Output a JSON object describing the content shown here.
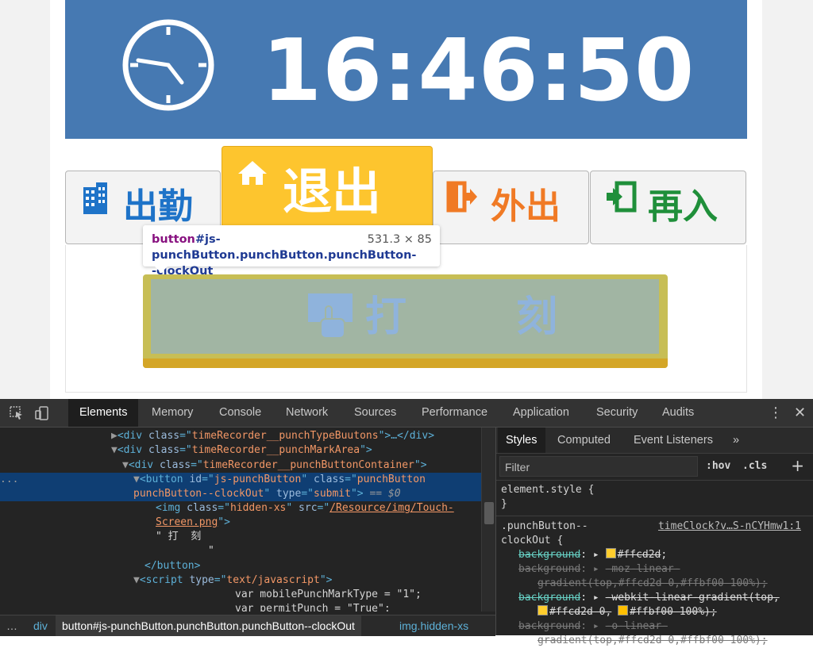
{
  "clock": {
    "time": "16:46:50"
  },
  "punch_types": {
    "clock_in": "出勤",
    "clock_out": "退出",
    "go_out": "外出",
    "return": "再入"
  },
  "punch_button": {
    "label": "打 刻"
  },
  "tooltip": {
    "tag": "button",
    "selector": "#js-punchButton.punchButton.punchButton--clockOut",
    "dimensions": "531.3 × 85"
  },
  "devtools": {
    "tabs": [
      "Elements",
      "Memory",
      "Console",
      "Network",
      "Sources",
      "Performance",
      "Application",
      "Security",
      "Audits"
    ],
    "active_tab": "Elements",
    "dom_lines": [
      {
        "tag": "div",
        "attr": "class",
        "value": "timeRecorder__punchTypeBuutons",
        "tail": ">…</div>"
      },
      {
        "tag": "div",
        "attr": "class",
        "value": "timeRecorder__punchMarkArea",
        "tail": ">"
      },
      {
        "tag": "div",
        "attr": "class",
        "value": "timeRecorder__punchButtonContainer",
        "tail": ">"
      },
      {
        "tag": "button",
        "attr1": "id",
        "value1": "js-punchButton",
        "attr2": "class",
        "value2a": "punchButton",
        "value2b": "punchButton--clockOut",
        "attr3": "type",
        "value3": "submit",
        "marker": "== $0"
      },
      {
        "tag": "img",
        "attr": "class",
        "value": "hidden-xs",
        "attr_src": "src",
        "src_a": "/Resource/img/Touch-",
        "src_b": "Screen.png"
      },
      {
        "text_a": "\" 打  刻",
        "text_b": "\""
      },
      {
        "close": "</button>"
      },
      {
        "tag": "script",
        "attr": "type",
        "value": "text/javascript"
      },
      {
        "js_a": "var mobilePunchMarkType = \"1\";",
        "js_b": "var permitPunch = \"True\";"
      }
    ],
    "breadcrumbs": [
      "…",
      "div",
      "button#js-punchButton.punchButton.punchButton--clockOut",
      "img.hidden-xs"
    ],
    "styles_tabs": [
      "Styles",
      "Computed",
      "Event Listeners",
      "»"
    ],
    "filter_placeholder": "Filter",
    "hov": ":hov",
    "cls": ".cls",
    "plus": "+",
    "element_style": "element.style {",
    "element_style_close": "}",
    "rule_selector_a": ".punchButton--",
    "rule_selector_b": "clockOut {",
    "rule_source": "timeClock?v…S-nCYHmw1:1",
    "decls": [
      {
        "prop": "background",
        "value": "#ffcd2d",
        "swatch": "#ffcd2d",
        "active": true
      },
      {
        "prop": "background",
        "value_a": "-moz-linear-",
        "value_b": "gradient(top,#ffcd2d 0,#ffbf00 100%);",
        "active": false
      },
      {
        "prop": "background",
        "value_a": "-webkit-linear-gradient(top,",
        "value_b_a": "#ffcd2d 0,",
        "value_b_b": "#ffbf00 100%);",
        "swatch1": "#ffcd2d",
        "swatch2": "#ffbf00",
        "active": true
      },
      {
        "prop": "background",
        "value_a": "-o-linear-",
        "value_b": "gradient(top,#ffcd2d 0,#ffbf00 100%);",
        "active": false
      }
    ]
  }
}
